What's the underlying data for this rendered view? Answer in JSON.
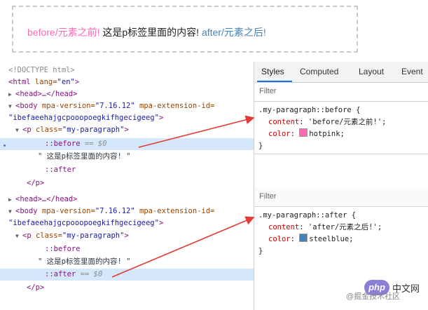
{
  "demo": {
    "before_text": "before/元素之前!",
    "middle_text": " 这是p标签里面的内容! ",
    "after_text": "after/元素之后!"
  },
  "elements_top": {
    "l1": "<!DOCTYPE html>",
    "l2_tag": "<html",
    "l2_attr": " lang=",
    "l2_val": "\"en\"",
    "l2_end": ">",
    "l3": "<head>…</head>",
    "l4_tag": "<body",
    "l4_a1": " mpa-version=",
    "l4_v1": "\"7.16.12\"",
    "l4_a2": " mpa-extension-id=",
    "l5_val": "\"ibefaeehajgcpooopoegkifhgecigeeg\"",
    "l5_end": ">",
    "l6_tag": "<p",
    "l6_attr": " class=",
    "l6_val": "\"my-paragraph\"",
    "l6_end": ">",
    "l7": "::before",
    "l7_eq": " == $0",
    "l8": "\" 这是p标签里面的内容! \"",
    "l9": "::after",
    "l10": "</p>"
  },
  "elements_bottom": {
    "l1": "<head>…</head>",
    "l2_tag": "<body",
    "l2_a1": " mpa-version=",
    "l2_v1": "\"7.16.12\"",
    "l2_a2": " mpa-extension-id=",
    "l3_val": "\"ibefaeehajgcpooopoegkifhgecigeeg\"",
    "l3_end": ">",
    "l4_tag": "<p",
    "l4_attr": " class=",
    "l4_val": "\"my-paragraph\"",
    "l4_end": ">",
    "l5": "::before",
    "l6": "\" 这是p标签里面的内容! \"",
    "l7": "::after",
    "l7_eq": " == $0",
    "l8": "</p>"
  },
  "styles_pane": {
    "tabs": [
      "Styles",
      "Computed",
      "Layout",
      "Event"
    ],
    "filter_label": "Filter",
    "rule_before": {
      "selector": ".my-paragraph::before {",
      "content_prop": "content",
      "content_val": "'before/元素之前!';",
      "color_prop": "color",
      "color_val": "hotpink;",
      "swatch": "#ff69b4",
      "close": "}"
    },
    "rule_after": {
      "selector": ".my-paragraph::after {",
      "content_prop": "content",
      "content_val": "'after/元素之后!';",
      "color_prop": "color",
      "color_val": "steelblue;",
      "swatch": "#4682b4",
      "close": "}"
    }
  },
  "watermark": {
    "logo": "php",
    "logo_cn": "中文网",
    "site": "@掘金技术社区"
  }
}
